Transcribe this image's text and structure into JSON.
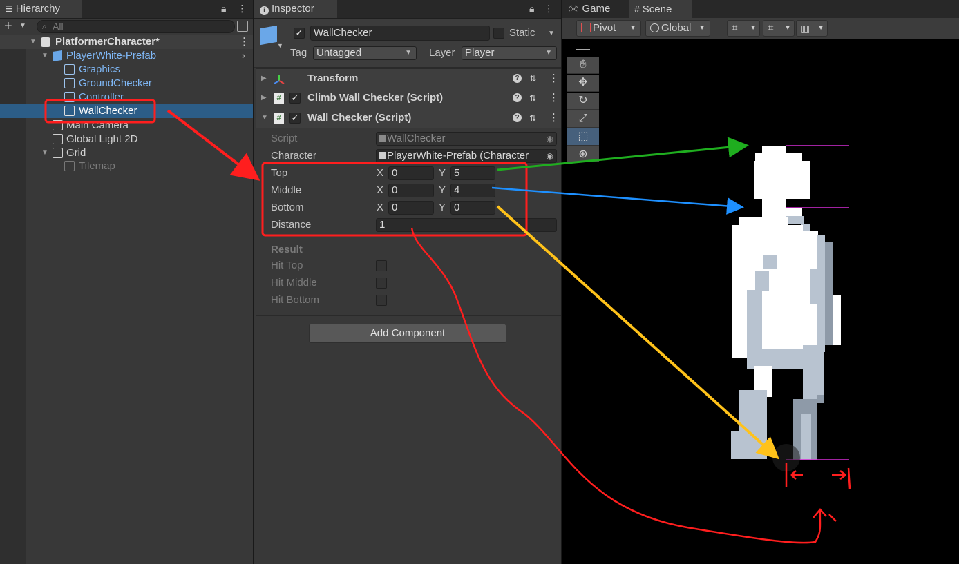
{
  "hierarchy": {
    "tab": "Hierarchy",
    "search_placeholder": "All",
    "scene": "PlatformerCharacter*",
    "items": [
      {
        "label": "PlayerWhite-Prefab"
      },
      {
        "label": "Graphics"
      },
      {
        "label": "GroundChecker"
      },
      {
        "label": "Controller"
      },
      {
        "label": "WallChecker"
      },
      {
        "label": "Main Camera"
      },
      {
        "label": "Global Light 2D"
      },
      {
        "label": "Grid"
      },
      {
        "label": "Tilemap"
      }
    ]
  },
  "inspector": {
    "tab": "Inspector",
    "object_name": "WallChecker",
    "static_label": "Static",
    "tag_label": "Tag",
    "tag_value": "Untagged",
    "layer_label": "Layer",
    "layer_value": "Player",
    "components": [
      {
        "name": "Transform"
      },
      {
        "name": "Climb Wall Checker (Script)"
      },
      {
        "name": "Wall Checker (Script)"
      }
    ],
    "fields": {
      "script_label": "Script",
      "script_value": "WallChecker",
      "character_label": "Character",
      "character_value": "PlayerWhite-Prefab (Character",
      "top_label": "Top",
      "middle_label": "Middle",
      "bottom_label": "Bottom",
      "distance_label": "Distance",
      "x": "X",
      "y": "Y",
      "top_x": "0",
      "top_y": "5",
      "middle_x": "0",
      "middle_y": "4",
      "bottom_x": "0",
      "bottom_y": "0",
      "distance": "1"
    },
    "result": {
      "title": "Result",
      "hit_top": "Hit Top",
      "hit_middle": "Hit Middle",
      "hit_bottom": "Hit Bottom"
    },
    "add_component": "Add Component"
  },
  "scene": {
    "game_tab": "Game",
    "scene_tab": "Scene",
    "pivot": "Pivot",
    "global": "Global"
  },
  "colors": {
    "selection": "#2c5d87",
    "annotation_red": "#ff1e1e",
    "arrow_green": "#1fae1f",
    "arrow_blue": "#1e90ff",
    "arrow_yellow": "#ffc21a",
    "gizmo_magenta": "#d62dd6"
  },
  "icons": [
    "cube-icon",
    "prefab-icon",
    "unity-icon",
    "info-icon",
    "gamepad-icon",
    "grid-icon",
    "hand-icon",
    "move-icon",
    "rotate-icon",
    "scale-icon",
    "rect-icon",
    "transform-icon",
    "help-icon",
    "kebab-icon",
    "lock-icon",
    "checkbox-icon"
  ]
}
